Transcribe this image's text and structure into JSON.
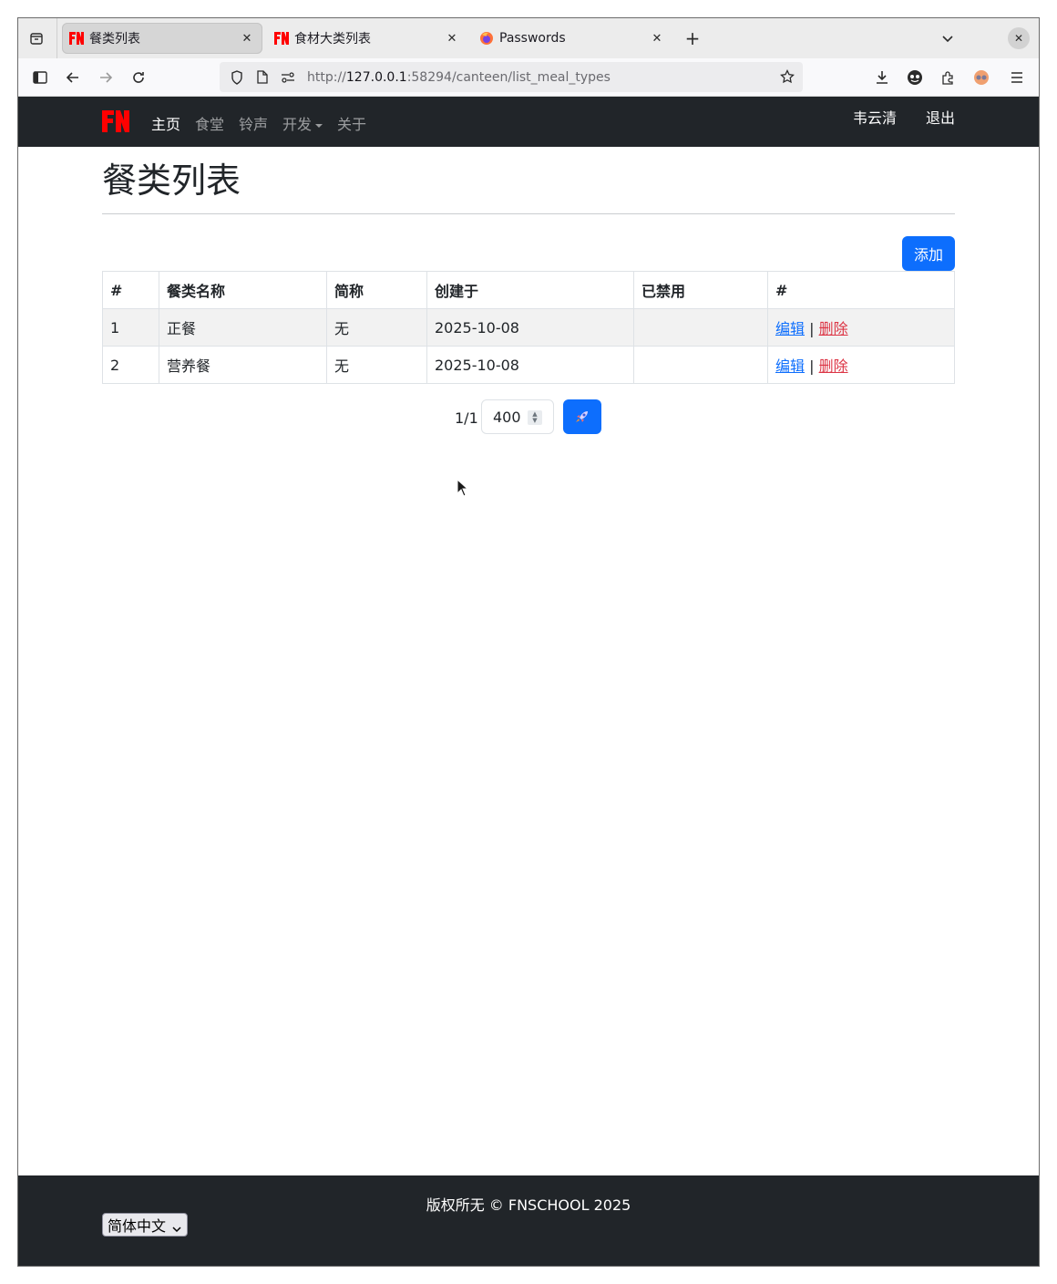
{
  "browser": {
    "tabs": [
      {
        "title": "餐类列表",
        "active": true
      },
      {
        "title": "食材大类列表",
        "active": false
      },
      {
        "title": "Passwords",
        "active": false
      }
    ],
    "url_host": "127.0.0.1",
    "url_prefix": "http://",
    "url_rest": ":58294/canteen/list_meal_types"
  },
  "navbar": {
    "items": [
      "主页",
      "食堂",
      "铃声",
      "开发",
      "关于"
    ],
    "user": "韦云清",
    "logout": "退出"
  },
  "page": {
    "title": "餐类列表",
    "add_button": "添加"
  },
  "table": {
    "headers": [
      "#",
      "餐类名称",
      "简称",
      "创建于",
      "已禁用",
      "#"
    ],
    "rows": [
      {
        "id": "1",
        "name": "正餐",
        "abbr": "无",
        "created": "2025-10-08",
        "disabled": "",
        "edit": "编辑",
        "delete": "删除"
      },
      {
        "id": "2",
        "name": "营养餐",
        "abbr": "无",
        "created": "2025-10-08",
        "disabled": "",
        "edit": "编辑",
        "delete": "删除"
      }
    ]
  },
  "pager": {
    "info": "1/1",
    "page_size": "400"
  },
  "footer": {
    "copyright": "版权所无 © FNSCHOOL 2025",
    "language": "简体中文"
  },
  "colors": {
    "primary": "#0d6efd",
    "danger": "#dc3545",
    "dark": "#212529",
    "brand_red": "#ff0000"
  }
}
